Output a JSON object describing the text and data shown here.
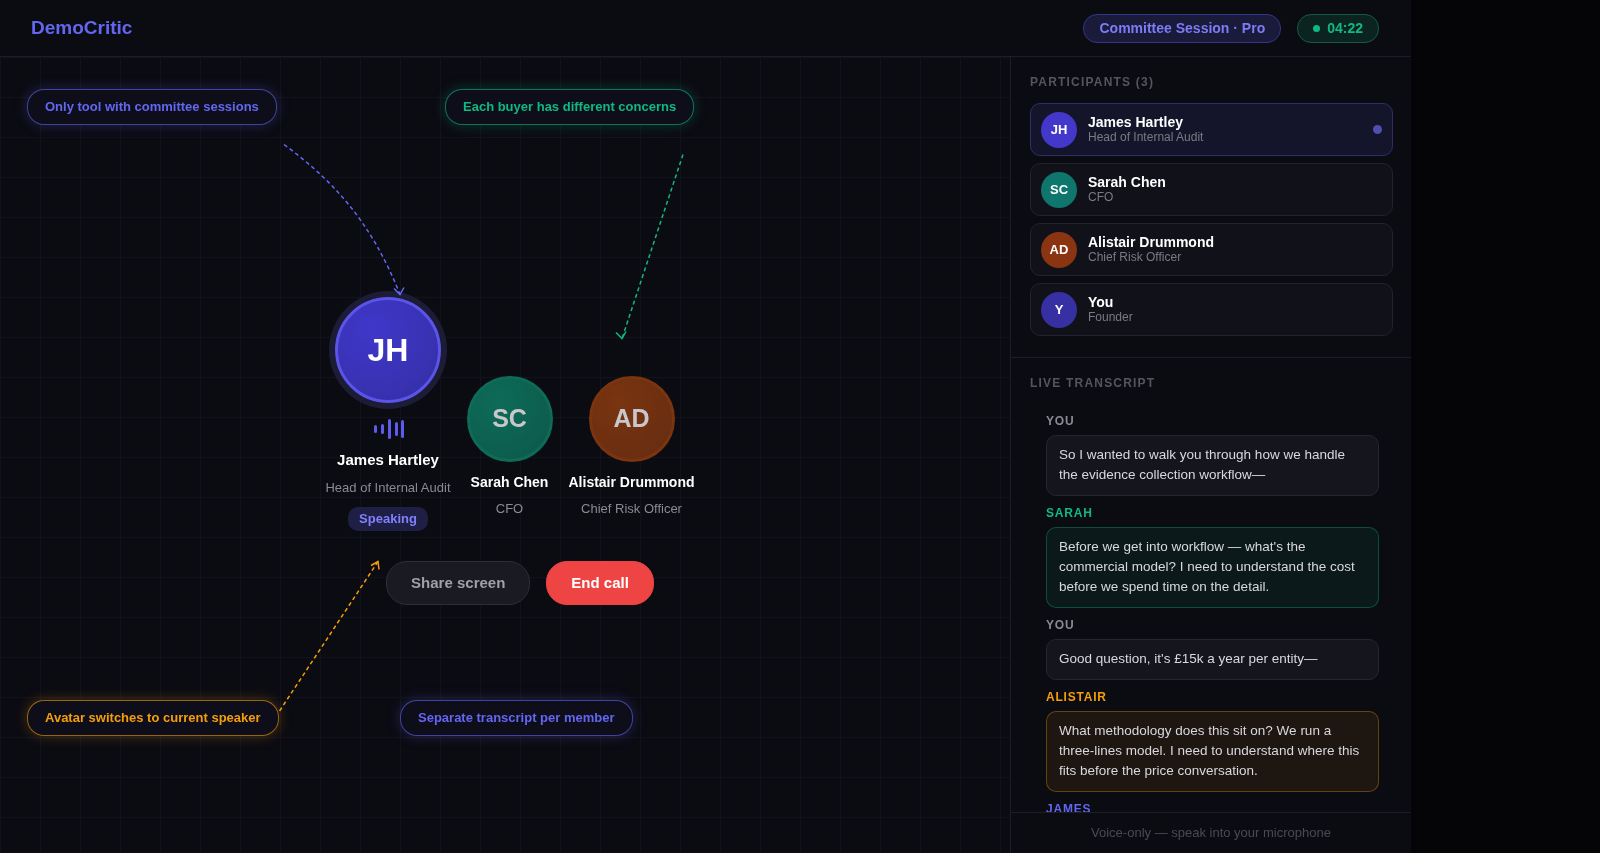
{
  "brand": "DemoCritic",
  "session_badge": "Committee Session · Pro",
  "timer": {
    "text": "04:22",
    "live": true
  },
  "callouts": [
    {
      "text": "Only tool with committee sessions",
      "color": "#6366f1"
    },
    {
      "text": "Each buyer has different concerns",
      "color": "#10b981"
    },
    {
      "text": "Avatar switches to current speaker",
      "color": "#f59e0b"
    },
    {
      "text": "Separate transcript per member",
      "color": "#6366f1"
    }
  ],
  "stage": {
    "participants": [
      {
        "initials": "JH",
        "name": "James Hartley",
        "role": "Head of Internal Audit",
        "speaking": true,
        "color": "#3f37c9"
      },
      {
        "initials": "SC",
        "name": "Sarah Chen",
        "role": "CFO",
        "speaking": false,
        "color": "#0d6b58"
      },
      {
        "initials": "AD",
        "name": "Alistair Drummond",
        "role": "Chief Risk Officer",
        "speaking": false,
        "color": "#7a3410"
      }
    ],
    "speaking_badge": "Speaking",
    "buttons": [
      {
        "label": "Share screen",
        "kind": "secondary"
      },
      {
        "label": "End call",
        "kind": "danger"
      }
    ]
  },
  "sidebar": {
    "participants_title": "PARTICIPANTS (3)",
    "participants": [
      {
        "initials": "JH",
        "name": "James Hartley",
        "role": "Head of Internal Audit",
        "selected": true,
        "color": "#4338ca"
      },
      {
        "initials": "SC",
        "name": "Sarah Chen",
        "role": "CFO",
        "selected": false,
        "color": "#0f766e"
      },
      {
        "initials": "AD",
        "name": "Alistair Drummond",
        "role": "Chief Risk Officer",
        "selected": false,
        "color": "#8a3412"
      },
      {
        "initials": "Y",
        "name": "You",
        "role": "Founder",
        "selected": false,
        "color": "#3730a3"
      }
    ],
    "transcript_title": "LIVE TRANSCRIPT",
    "transcript": [
      {
        "speaker": "YOU",
        "text": "So I wanted to walk you through how we handle the evidence collection workflow—",
        "color": "#8a8a94"
      },
      {
        "speaker": "SARAH",
        "text": "Before we get into workflow — what's the commercial model? I need to understand the cost before we spend time on the detail.",
        "color": "#10b981"
      },
      {
        "speaker": "YOU",
        "text": "Good question, it's £15k a year per entity—",
        "color": "#8a8a94"
      },
      {
        "speaker": "ALISTAIR",
        "text": "What methodology does this sit on? We run a three-lines model. I need to understand where this fits before the price conversation.",
        "color": "#f59e0b"
      },
      {
        "speaker": "JAMES",
        "color": "#6366f1"
      }
    ],
    "footer": "Voice-only — speak into your microphone"
  }
}
